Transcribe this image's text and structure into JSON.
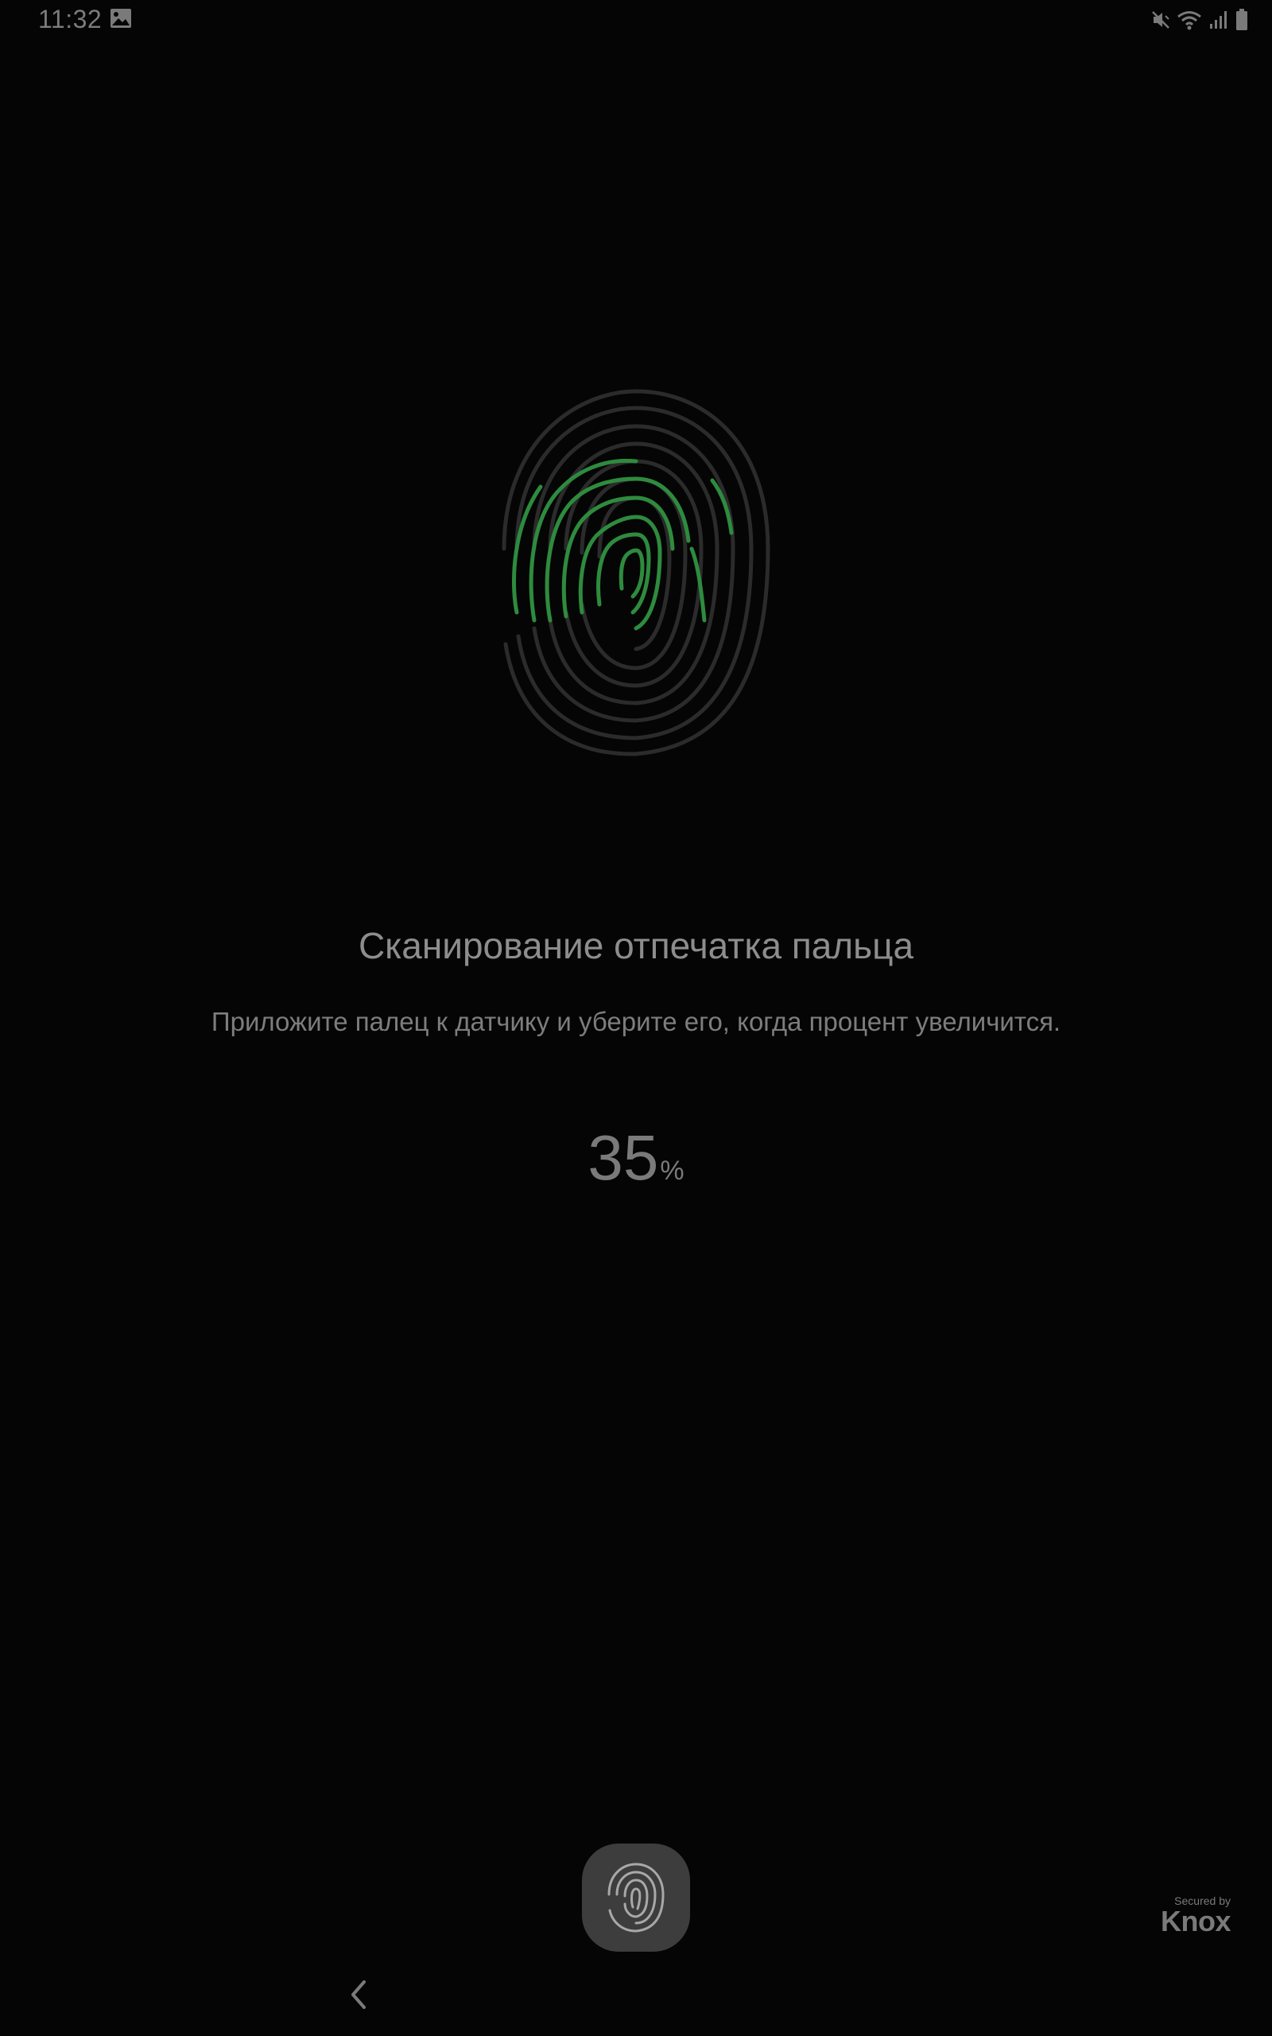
{
  "status_bar": {
    "time": "11:32",
    "left_icons": [
      "gallery-icon"
    ],
    "right_icons": [
      "mute-vibrate-icon",
      "wifi-icon",
      "signal-icon",
      "battery-icon"
    ]
  },
  "fingerprint_illustration": {
    "icon": "fingerprint-icon",
    "progress_color": "#2e8b3e",
    "base_color": "#2b2b2b"
  },
  "main": {
    "title": "Сканирование отпечатка пальца",
    "instructions": "Приложите палец к датчику и уберите его, когда процент увеличится.",
    "progress_value": "35",
    "progress_unit": "%",
    "progress_fraction": 0.35
  },
  "footer": {
    "sensor_icon": "fingerprint-sensor-icon",
    "knox_secured": "Secured by",
    "knox_brand": "Knox",
    "nav_back_icon": "chevron-left-icon"
  }
}
